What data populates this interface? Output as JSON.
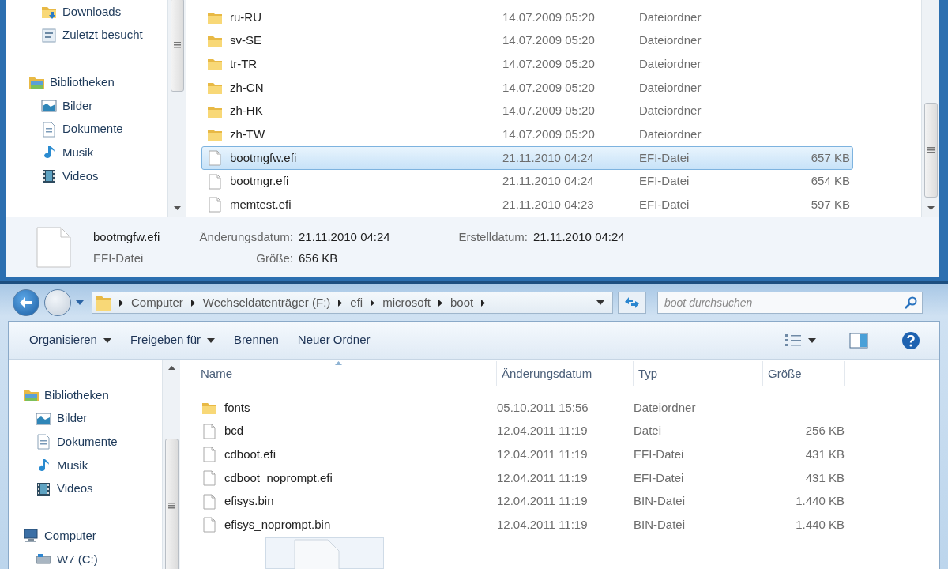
{
  "windows": [
    {
      "sidebar": {
        "groups": [
          {
            "children": [
              {
                "label": "Downloads",
                "kind": "downloads"
              },
              {
                "label": "Zuletzt besucht",
                "kind": "recent"
              }
            ]
          },
          {
            "label": "Bibliotheken",
            "kind": "library",
            "children": [
              {
                "label": "Bilder",
                "kind": "pictures"
              },
              {
                "label": "Dokumente",
                "kind": "documents"
              },
              {
                "label": "Musik",
                "kind": "music"
              },
              {
                "label": "Videos",
                "kind": "videos"
              }
            ]
          }
        ]
      },
      "files": [
        {
          "name": "ru-RU",
          "date": "14.07.2009 05:20",
          "type": "Dateiordner",
          "kind": "folder",
          "selected": false
        },
        {
          "name": "sv-SE",
          "date": "14.07.2009 05:20",
          "type": "Dateiordner",
          "kind": "folder",
          "selected": false
        },
        {
          "name": "tr-TR",
          "date": "14.07.2009 05:20",
          "type": "Dateiordner",
          "kind": "folder",
          "selected": false
        },
        {
          "name": "zh-CN",
          "date": "14.07.2009 05:20",
          "type": "Dateiordner",
          "kind": "folder",
          "selected": false
        },
        {
          "name": "zh-HK",
          "date": "14.07.2009 05:20",
          "type": "Dateiordner",
          "kind": "folder",
          "selected": false
        },
        {
          "name": "zh-TW",
          "date": "14.07.2009 05:20",
          "type": "Dateiordner",
          "kind": "folder",
          "selected": false
        },
        {
          "name": "bootmgfw.efi",
          "date": "21.11.2010 04:24",
          "type": "EFI-Datei",
          "size": "657 KB",
          "kind": "file",
          "selected": true
        },
        {
          "name": "bootmgr.efi",
          "date": "21.11.2010 04:24",
          "type": "EFI-Datei",
          "size": "654 KB",
          "kind": "file",
          "selected": false
        },
        {
          "name": "memtest.efi",
          "date": "21.11.2010 04:23",
          "type": "EFI-Datei",
          "size": "597 KB",
          "kind": "file",
          "selected": false
        }
      ],
      "details": {
        "name": "bootmgfw.efi",
        "type": "EFI-Datei",
        "fields": [
          {
            "label": "Änderungsdatum:",
            "value": "21.11.2010 04:24"
          },
          {
            "label": "Größe:",
            "value": "656 KB"
          },
          {
            "label": "Erstelldatum:",
            "value": "21.11.2010 04:24"
          }
        ]
      }
    },
    {
      "address": [
        "Computer",
        "Wechseldatenträger (F:)",
        "efi",
        "microsoft",
        "boot"
      ],
      "search": {
        "placeholder": "boot durchsuchen"
      },
      "toolbar": [
        {
          "label": "Organisieren",
          "dropdown": true
        },
        {
          "label": "Freigeben für",
          "dropdown": true
        },
        {
          "label": "Brennen",
          "dropdown": false
        },
        {
          "label": "Neuer Ordner",
          "dropdown": false
        }
      ],
      "sidebar": {
        "groups": [
          {
            "label": "Bibliotheken",
            "kind": "library",
            "children": [
              {
                "label": "Bilder",
                "kind": "pictures"
              },
              {
                "label": "Dokumente",
                "kind": "documents"
              },
              {
                "label": "Musik",
                "kind": "music"
              },
              {
                "label": "Videos",
                "kind": "videos"
              }
            ]
          },
          {
            "label": "Computer",
            "kind": "computer",
            "children": [
              {
                "label": "W7 (C:)",
                "kind": "drive"
              }
            ]
          }
        ]
      },
      "columns": [
        "Name",
        "Änderungsdatum",
        "Typ",
        "Größe"
      ],
      "files": [
        {
          "name": "fonts",
          "date": "05.10.2011 15:56",
          "type": "Dateiordner",
          "kind": "folder",
          "selected": false
        },
        {
          "name": "bcd",
          "date": "12.04.2011 11:19",
          "type": "Datei",
          "size": "256 KB",
          "kind": "file",
          "selected": false
        },
        {
          "name": "cdboot.efi",
          "date": "12.04.2011 11:19",
          "type": "EFI-Datei",
          "size": "431 KB",
          "kind": "file",
          "selected": false
        },
        {
          "name": "cdboot_noprompt.efi",
          "date": "12.04.2011 11:19",
          "type": "EFI-Datei",
          "size": "431 KB",
          "kind": "file",
          "selected": false
        },
        {
          "name": "efisys.bin",
          "date": "12.04.2011 11:19",
          "type": "BIN-Datei",
          "size": "1.440 KB",
          "kind": "file",
          "selected": false
        },
        {
          "name": "efisys_noprompt.bin",
          "date": "12.04.2011 11:19",
          "type": "BIN-Datei",
          "size": "1.440 KB",
          "kind": "file",
          "selected": false
        }
      ]
    }
  ]
}
